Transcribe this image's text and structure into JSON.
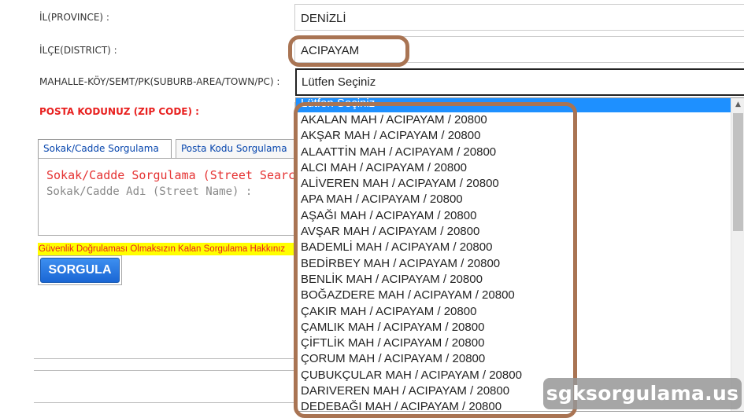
{
  "form": {
    "province_label": "İL(PROVINCE) :",
    "province_value": "DENİZLİ",
    "district_label": "İLÇE(DISTRICT) :",
    "district_value": "ACIPAYAM",
    "suburb_label": "MAHALLE-KÖY/SEMT/PK(SUBURB-AREA/TOWN/PC) :",
    "suburb_selected": "Lütfen Seçiniz",
    "zip_label": "POSTA KODUNUZ (ZIP CODE) :"
  },
  "dropdown": {
    "header": "Lütfen Seçiniz",
    "options": [
      "AKALAN MAH / ACIPAYAM / 20800",
      "AKŞAR MAH / ACIPAYAM / 20800",
      "ALAATTİN MAH / ACIPAYAM / 20800",
      "ALCI MAH / ACIPAYAM / 20800",
      "ALİVEREN MAH / ACIPAYAM / 20800",
      "APA MAH / ACIPAYAM / 20800",
      "AŞAĞI MAH / ACIPAYAM / 20800",
      "AVŞAR MAH / ACIPAYAM / 20800",
      "BADEMLİ MAH / ACIPAYAM / 20800",
      "BEDİRBEY MAH / ACIPAYAM / 20800",
      "BENLİK MAH / ACIPAYAM / 20800",
      "BOĞAZDERE MAH / ACIPAYAM / 20800",
      "ÇAKIR MAH / ACIPAYAM / 20800",
      "ÇAMLIK MAH / ACIPAYAM / 20800",
      "ÇİFTLİK MAH / ACIPAYAM / 20800",
      "ÇORUM MAH / ACIPAYAM / 20800",
      "ÇUBUKÇULAR MAH / ACIPAYAM / 20800",
      "DARIVEREN MAH / ACIPAYAM / 20800",
      "DEDEBAĞI MAH / ACIPAYAM / 20800"
    ]
  },
  "tabs": {
    "street": "Sokak/Cadde Sorgulama",
    "zip": "Posta Kodu Sorgulama"
  },
  "panel": {
    "title": "Sokak/Cadde Sorgulama (Street Search)",
    "street_name_label": "Sokak/Cadde Adı (Street Name) :"
  },
  "warning_text": "Güvenlik Doğrulaması Olmaksızın Kalan Sorgulama Hakkınız",
  "button_label": "SORGULA",
  "watermark": "sgksorgulama.us",
  "colors": {
    "highlight": "#a97453",
    "selected_option": "#1e90ff",
    "zip_label": "#e8201f",
    "warning_bg": "#ffff00",
    "button": "#1a66d4"
  }
}
